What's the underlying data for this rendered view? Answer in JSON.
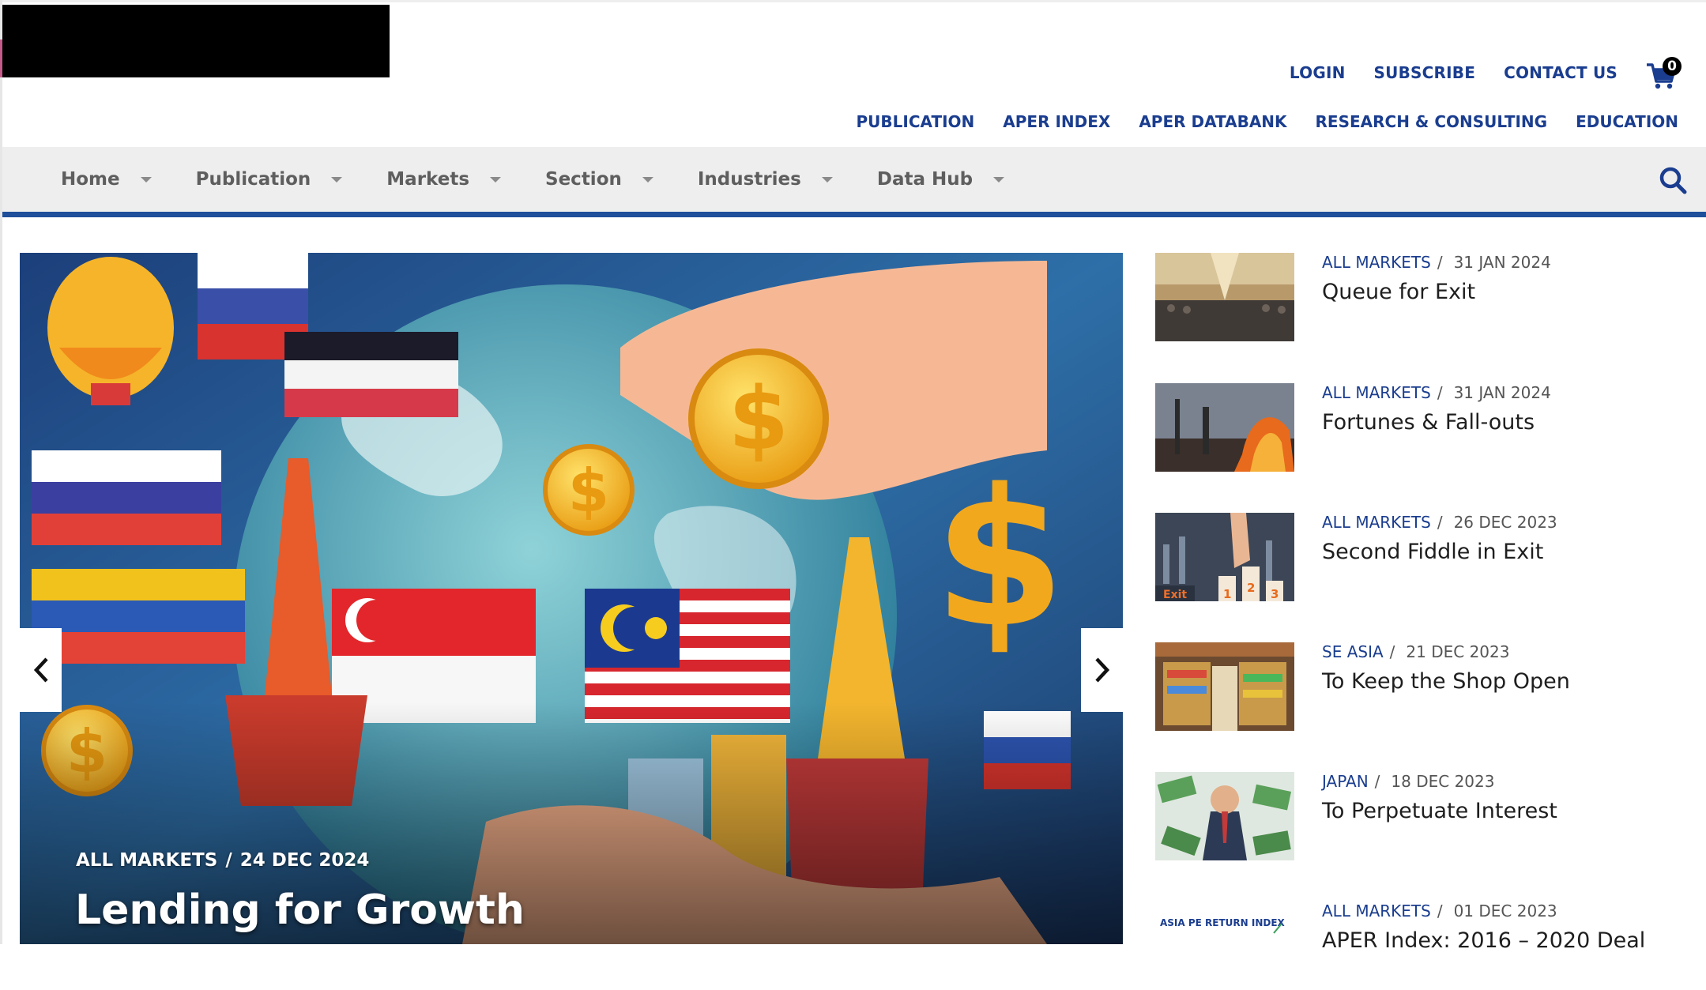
{
  "header": {
    "util_links": [
      "LOGIN",
      "SUBSCRIBE",
      "CONTACT US"
    ],
    "cart_count": "0",
    "pub_links": [
      "PUBLICATION",
      "APER INDEX",
      "APER DATABANK",
      "RESEARCH & CONSULTING",
      "EDUCATION"
    ]
  },
  "nav": {
    "items": [
      "Home",
      "Publication",
      "Markets",
      "Section",
      "Industries",
      "Data Hub"
    ]
  },
  "slider": {
    "category": "ALL MARKETS",
    "separator": "/",
    "date": "24 DEC 2024",
    "title": "Lending for Growth"
  },
  "side": {
    "items": [
      {
        "category": "ALL MARKETS",
        "date": "31 JAN 2024",
        "title": "Queue for Exit"
      },
      {
        "category": "ALL MARKETS",
        "date": "31 JAN 2024",
        "title": "Fortunes & Fall-outs"
      },
      {
        "category": "ALL MARKETS",
        "date": "26 DEC 2023",
        "title": "Second Fiddle in Exit"
      },
      {
        "category": "SE ASIA",
        "date": "21 DEC 2023",
        "title": "To Keep the Shop Open"
      },
      {
        "category": "JAPAN",
        "date": "18 DEC 2023",
        "title": "To Perpetuate Interest"
      },
      {
        "category": "ALL MARKETS",
        "date": "01 DEC 2023",
        "title": "APER Index: 2016 – 2020 Deal"
      }
    ],
    "separator": "/",
    "thumb_texts": {
      "exit_label": "Exit",
      "podium_1": "1",
      "podium_2": "2",
      "podium_3": "3",
      "index_label": "ASIA PE RETURN INDEX"
    }
  },
  "colors": {
    "brand_blue": "#1a3d8f",
    "nav_bar": "#eeeeee",
    "nav_underline": "#1f4e9b"
  }
}
